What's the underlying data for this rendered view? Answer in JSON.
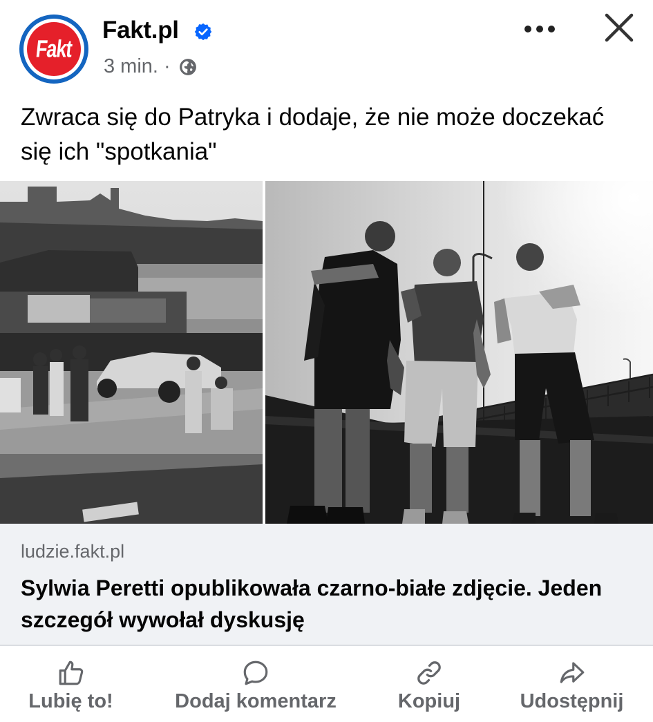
{
  "post": {
    "page_name": "Fakt.pl",
    "avatar_text": "Fakt",
    "timestamp": "3 min.",
    "separator": "·",
    "privacy_icon": "globe-icon",
    "verified_icon": "verified-badge-icon",
    "text": "Zwraca się do Patryka i dodaje, że nie może doczekać się ich \"spotkania\""
  },
  "link": {
    "domain": "ludzie.fakt.pl",
    "headline": "Sylwia Peretti opublikowała czarno-białe zdjęcie. Jeden szczegół wywołał dyskusję"
  },
  "actions": [
    {
      "label": "Lubię to!",
      "icon": "thumbs-up-icon"
    },
    {
      "label": "Dodaj komentarz",
      "icon": "comment-icon"
    },
    {
      "label": "Kopiuj",
      "icon": "link-icon"
    },
    {
      "label": "Udostępnij",
      "icon": "share-icon"
    }
  ],
  "colors": {
    "brand_red": "#e5202a",
    "brand_blue": "#1465c0",
    "verified_blue": "#0866ff",
    "muted_text": "#65676b",
    "card_bg": "#f0f2f5"
  }
}
